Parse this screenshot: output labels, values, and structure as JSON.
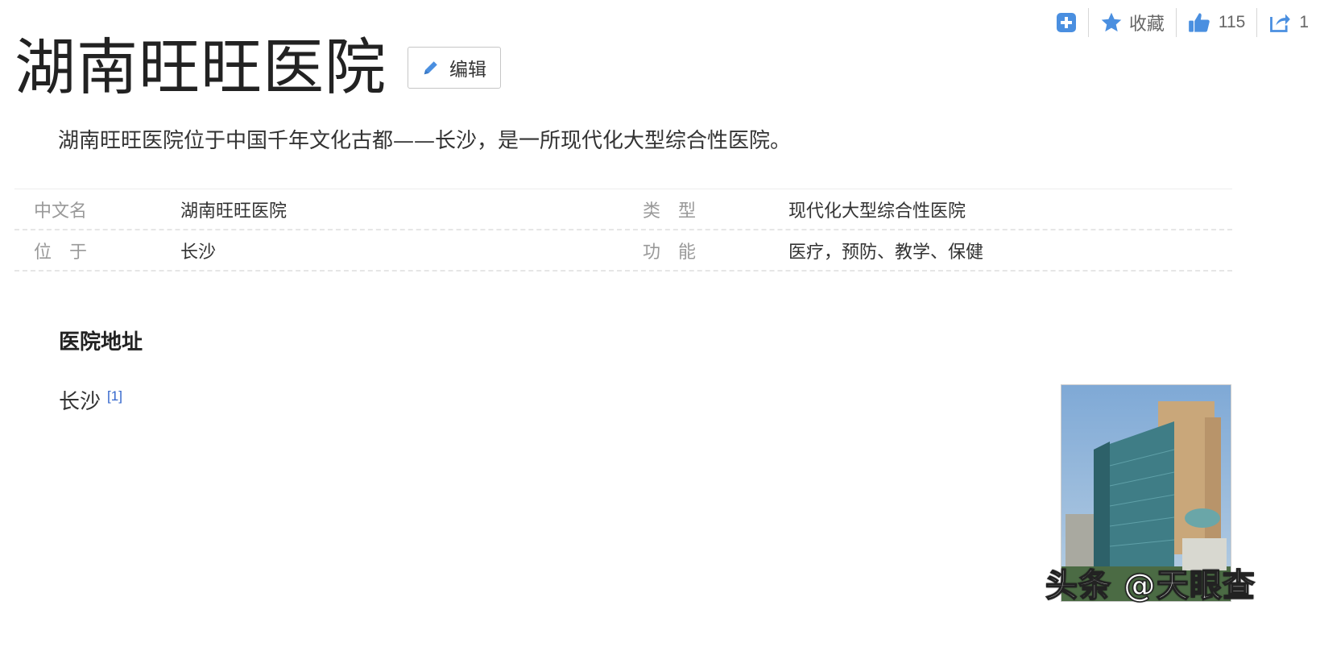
{
  "toolbar": {
    "add_icon": "plus-square-icon",
    "favorite_label": "收藏",
    "like_count": "115",
    "share_count": "1",
    "accent_color": "#4a8fe0"
  },
  "title": "湖南旺旺医院",
  "edit_label": "编辑",
  "summary": "湖南旺旺医院位于中国千年文化古都——长沙，是一所现代化大型综合性医院。",
  "info": {
    "rows": [
      {
        "k1": "中文名",
        "v1": "湖南旺旺医院",
        "k2": "类　型",
        "v2": "现代化大型综合性医院"
      },
      {
        "k1": "位　于",
        "v1": "长沙",
        "k2": "功　能",
        "v2": "医疗，预防、教学、保健"
      }
    ]
  },
  "section": {
    "title": "医院地址",
    "address": "长沙",
    "ref": "[1]"
  },
  "watermark": "头条 @天眼查"
}
